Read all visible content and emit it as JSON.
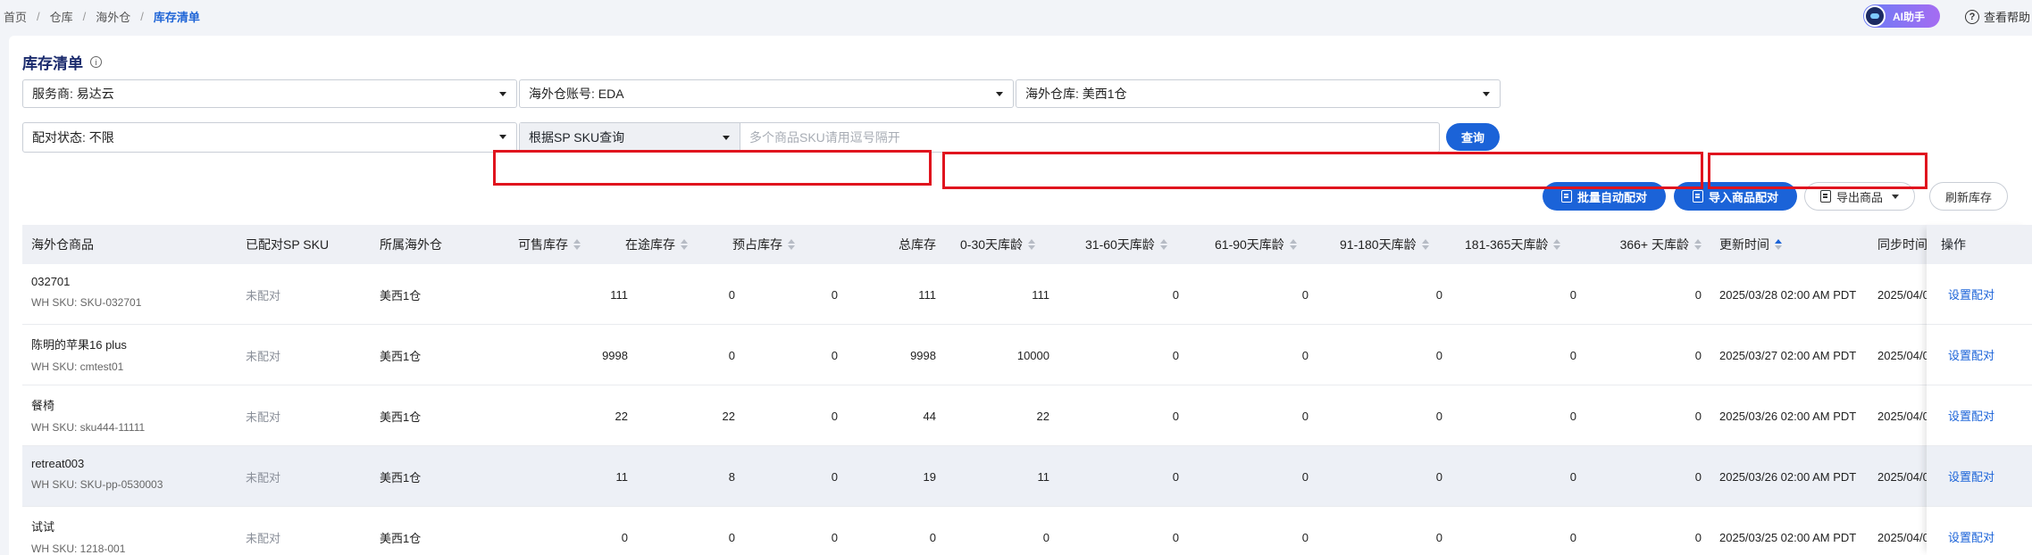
{
  "breadcrumb": [
    "首页",
    "仓库",
    "海外仓",
    "库存清单"
  ],
  "header": {
    "ai_label": "AI助手",
    "help_label": "查看帮助"
  },
  "page": {
    "title": "库存清单"
  },
  "filters": {
    "provider": "服务商: 易达云",
    "account": "海外仓账号: EDA",
    "warehouse": "海外仓库: 美西1仓",
    "match_status": "配对状态: 不限",
    "query_type": "根据SP SKU查询",
    "query_placeholder": "多个商品SKU请用逗号隔开",
    "query_button": "查询"
  },
  "toolbar": {
    "batch_auto_match": "批量自动配对",
    "import_match": "导入商品配对",
    "export": "导出商品",
    "refresh": "刷新库存"
  },
  "columns": {
    "product": "海外仓商品",
    "sp_sku": "已配对SP SKU",
    "warehouse": "所属海外仓",
    "available": "可售库存",
    "in_transit": "在途库存",
    "reserved": "预占库存",
    "total": "总库存",
    "age_0_30": "0-30天库龄",
    "age_31_60": "31-60天库龄",
    "age_61_90": "61-90天库龄",
    "age_91_180": "91-180天库龄",
    "age_181_365": "181-365天库龄",
    "age_366": "366+ 天库龄",
    "updated": "更新时间",
    "synced": "同步时间",
    "action": "操作"
  },
  "rows": [
    {
      "name": "032701",
      "wh_sku": "WH SKU: SKU-032701",
      "sp_sku": "未配对",
      "warehouse": "美西1仓",
      "available": "111",
      "in_transit": "0",
      "reserved": "0",
      "total": "111",
      "a1": "111",
      "a2": "0",
      "a3": "0",
      "a4": "0",
      "a5": "0",
      "a6": "0",
      "updated": "2025/03/28 02:00 AM PDT",
      "synced": "2025/04/0",
      "action": "设置配对"
    },
    {
      "name": "陈明的苹果16 plus",
      "wh_sku": "WH SKU: cmtest01",
      "sp_sku": "未配对",
      "warehouse": "美西1仓",
      "available": "9998",
      "in_transit": "0",
      "reserved": "0",
      "total": "9998",
      "a1": "10000",
      "a2": "0",
      "a3": "0",
      "a4": "0",
      "a5": "0",
      "a6": "0",
      "updated": "2025/03/27 02:00 AM PDT",
      "synced": "2025/04/0",
      "action": "设置配对"
    },
    {
      "name": "餐椅",
      "wh_sku": "WH SKU: sku444-11111",
      "sp_sku": "未配对",
      "warehouse": "美西1仓",
      "available": "22",
      "in_transit": "22",
      "reserved": "0",
      "total": "44",
      "a1": "22",
      "a2": "0",
      "a3": "0",
      "a4": "0",
      "a5": "0",
      "a6": "0",
      "updated": "2025/03/26 02:00 AM PDT",
      "synced": "2025/04/0",
      "action": "设置配对"
    },
    {
      "name": "retreat003",
      "wh_sku": "WH SKU: SKU-pp-0530003",
      "sp_sku": "未配对",
      "warehouse": "美西1仓",
      "available": "11",
      "in_transit": "8",
      "reserved": "0",
      "total": "19",
      "a1": "11",
      "a2": "0",
      "a3": "0",
      "a4": "0",
      "a5": "0",
      "a6": "0",
      "updated": "2025/03/26 02:00 AM PDT",
      "synced": "2025/04/0",
      "action": "设置配对"
    },
    {
      "name": "试试",
      "wh_sku": "WH SKU: 1218-001",
      "sp_sku": "未配对",
      "warehouse": "美西1仓",
      "available": "0",
      "in_transit": "0",
      "reserved": "0",
      "total": "0",
      "a1": "0",
      "a2": "0",
      "a3": "0",
      "a4": "0",
      "a5": "0",
      "a6": "0",
      "updated": "2025/03/25 02:00 AM PDT",
      "synced": "2025/04/0",
      "action": "设置配对"
    }
  ],
  "colors": {
    "primary": "#1b63d8",
    "highlight_box": "#e0141e",
    "title": "#1a2a6c"
  }
}
